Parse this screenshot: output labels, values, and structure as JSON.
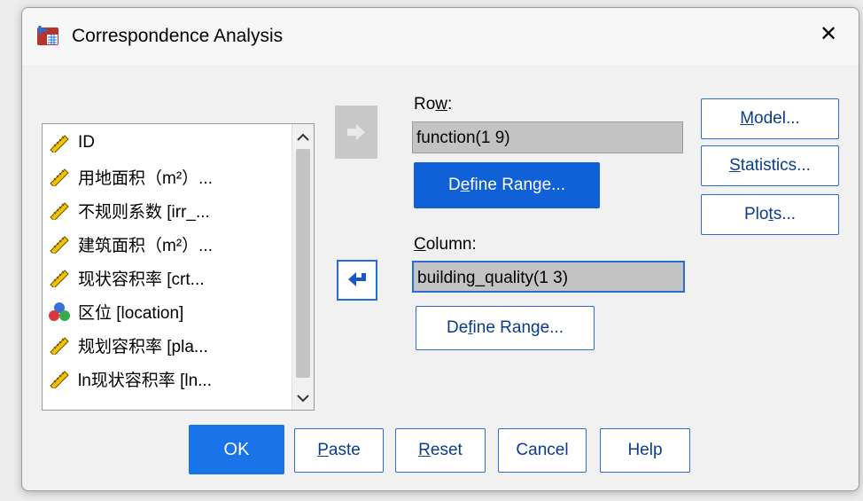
{
  "window": {
    "title": "Correspondence Analysis",
    "close_glyph": "✕"
  },
  "variables": [
    {
      "label": "ID",
      "icon": "ruler-icon"
    },
    {
      "label": "用地面积（m²）...",
      "icon": "ruler-icon"
    },
    {
      "label": "不规则系数 [irr_...",
      "icon": "ruler-icon"
    },
    {
      "label": "建筑面积（m²）...",
      "icon": "ruler-icon"
    },
    {
      "label": "现状容积率 [crt...",
      "icon": "ruler-icon"
    },
    {
      "label": "区位 [location]",
      "icon": "nominal-icon"
    },
    {
      "label": "规划容积率 [pla...",
      "icon": "ruler-icon"
    },
    {
      "label": "ln现状容积率 [ln...",
      "icon": "ruler-icon"
    }
  ],
  "row": {
    "label_pre": "Ro",
    "label_ul": "w",
    "label_post": ":",
    "value": "function(1 9)",
    "define_pre": "D",
    "define_ul": "e",
    "define_post": "fine Range..."
  },
  "column": {
    "label_pre": "",
    "label_ul": "C",
    "label_post": "olumn:",
    "value": "building_quality(1 3)",
    "define_pre": "De",
    "define_ul": "f",
    "define_post": "ine Range..."
  },
  "side_buttons": {
    "model_pre": "",
    "model_ul": "M",
    "model_post": "odel...",
    "stats_pre": "",
    "stats_ul": "S",
    "stats_post": "tatistics...",
    "plots_pre": "Plo",
    "plots_ul": "t",
    "plots_post": "s..."
  },
  "bottom_buttons": {
    "ok": "OK",
    "paste_ul": "P",
    "paste_post": "aste",
    "reset_ul": "R",
    "reset_post": "eset",
    "cancel": "Cancel",
    "help": "Help"
  },
  "colors": {
    "accent": "#1a73e8",
    "active_border": "#2a6bd6",
    "field_bg": "#c3c3c3"
  }
}
